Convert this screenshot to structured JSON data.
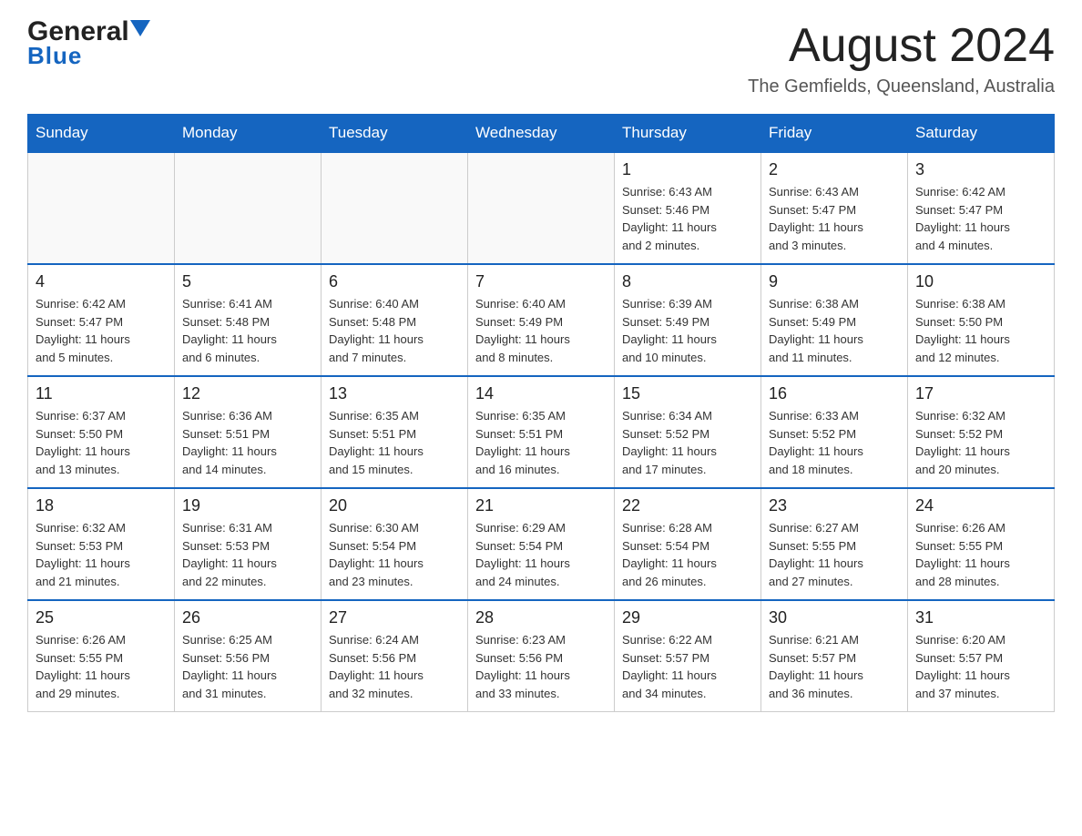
{
  "logo": {
    "line1_black": "General",
    "line1_blue": "Blue",
    "line2": "Blue"
  },
  "header": {
    "month_year": "August 2024",
    "location": "The Gemfields, Queensland, Australia"
  },
  "days_of_week": [
    "Sunday",
    "Monday",
    "Tuesday",
    "Wednesday",
    "Thursday",
    "Friday",
    "Saturday"
  ],
  "weeks": [
    [
      {
        "day": "",
        "info": ""
      },
      {
        "day": "",
        "info": ""
      },
      {
        "day": "",
        "info": ""
      },
      {
        "day": "",
        "info": ""
      },
      {
        "day": "1",
        "info": "Sunrise: 6:43 AM\nSunset: 5:46 PM\nDaylight: 11 hours\nand 2 minutes."
      },
      {
        "day": "2",
        "info": "Sunrise: 6:43 AM\nSunset: 5:47 PM\nDaylight: 11 hours\nand 3 minutes."
      },
      {
        "day": "3",
        "info": "Sunrise: 6:42 AM\nSunset: 5:47 PM\nDaylight: 11 hours\nand 4 minutes."
      }
    ],
    [
      {
        "day": "4",
        "info": "Sunrise: 6:42 AM\nSunset: 5:47 PM\nDaylight: 11 hours\nand 5 minutes."
      },
      {
        "day": "5",
        "info": "Sunrise: 6:41 AM\nSunset: 5:48 PM\nDaylight: 11 hours\nand 6 minutes."
      },
      {
        "day": "6",
        "info": "Sunrise: 6:40 AM\nSunset: 5:48 PM\nDaylight: 11 hours\nand 7 minutes."
      },
      {
        "day": "7",
        "info": "Sunrise: 6:40 AM\nSunset: 5:49 PM\nDaylight: 11 hours\nand 8 minutes."
      },
      {
        "day": "8",
        "info": "Sunrise: 6:39 AM\nSunset: 5:49 PM\nDaylight: 11 hours\nand 10 minutes."
      },
      {
        "day": "9",
        "info": "Sunrise: 6:38 AM\nSunset: 5:49 PM\nDaylight: 11 hours\nand 11 minutes."
      },
      {
        "day": "10",
        "info": "Sunrise: 6:38 AM\nSunset: 5:50 PM\nDaylight: 11 hours\nand 12 minutes."
      }
    ],
    [
      {
        "day": "11",
        "info": "Sunrise: 6:37 AM\nSunset: 5:50 PM\nDaylight: 11 hours\nand 13 minutes."
      },
      {
        "day": "12",
        "info": "Sunrise: 6:36 AM\nSunset: 5:51 PM\nDaylight: 11 hours\nand 14 minutes."
      },
      {
        "day": "13",
        "info": "Sunrise: 6:35 AM\nSunset: 5:51 PM\nDaylight: 11 hours\nand 15 minutes."
      },
      {
        "day": "14",
        "info": "Sunrise: 6:35 AM\nSunset: 5:51 PM\nDaylight: 11 hours\nand 16 minutes."
      },
      {
        "day": "15",
        "info": "Sunrise: 6:34 AM\nSunset: 5:52 PM\nDaylight: 11 hours\nand 17 minutes."
      },
      {
        "day": "16",
        "info": "Sunrise: 6:33 AM\nSunset: 5:52 PM\nDaylight: 11 hours\nand 18 minutes."
      },
      {
        "day": "17",
        "info": "Sunrise: 6:32 AM\nSunset: 5:52 PM\nDaylight: 11 hours\nand 20 minutes."
      }
    ],
    [
      {
        "day": "18",
        "info": "Sunrise: 6:32 AM\nSunset: 5:53 PM\nDaylight: 11 hours\nand 21 minutes."
      },
      {
        "day": "19",
        "info": "Sunrise: 6:31 AM\nSunset: 5:53 PM\nDaylight: 11 hours\nand 22 minutes."
      },
      {
        "day": "20",
        "info": "Sunrise: 6:30 AM\nSunset: 5:54 PM\nDaylight: 11 hours\nand 23 minutes."
      },
      {
        "day": "21",
        "info": "Sunrise: 6:29 AM\nSunset: 5:54 PM\nDaylight: 11 hours\nand 24 minutes."
      },
      {
        "day": "22",
        "info": "Sunrise: 6:28 AM\nSunset: 5:54 PM\nDaylight: 11 hours\nand 26 minutes."
      },
      {
        "day": "23",
        "info": "Sunrise: 6:27 AM\nSunset: 5:55 PM\nDaylight: 11 hours\nand 27 minutes."
      },
      {
        "day": "24",
        "info": "Sunrise: 6:26 AM\nSunset: 5:55 PM\nDaylight: 11 hours\nand 28 minutes."
      }
    ],
    [
      {
        "day": "25",
        "info": "Sunrise: 6:26 AM\nSunset: 5:55 PM\nDaylight: 11 hours\nand 29 minutes."
      },
      {
        "day": "26",
        "info": "Sunrise: 6:25 AM\nSunset: 5:56 PM\nDaylight: 11 hours\nand 31 minutes."
      },
      {
        "day": "27",
        "info": "Sunrise: 6:24 AM\nSunset: 5:56 PM\nDaylight: 11 hours\nand 32 minutes."
      },
      {
        "day": "28",
        "info": "Sunrise: 6:23 AM\nSunset: 5:56 PM\nDaylight: 11 hours\nand 33 minutes."
      },
      {
        "day": "29",
        "info": "Sunrise: 6:22 AM\nSunset: 5:57 PM\nDaylight: 11 hours\nand 34 minutes."
      },
      {
        "day": "30",
        "info": "Sunrise: 6:21 AM\nSunset: 5:57 PM\nDaylight: 11 hours\nand 36 minutes."
      },
      {
        "day": "31",
        "info": "Sunrise: 6:20 AM\nSunset: 5:57 PM\nDaylight: 11 hours\nand 37 minutes."
      }
    ]
  ]
}
